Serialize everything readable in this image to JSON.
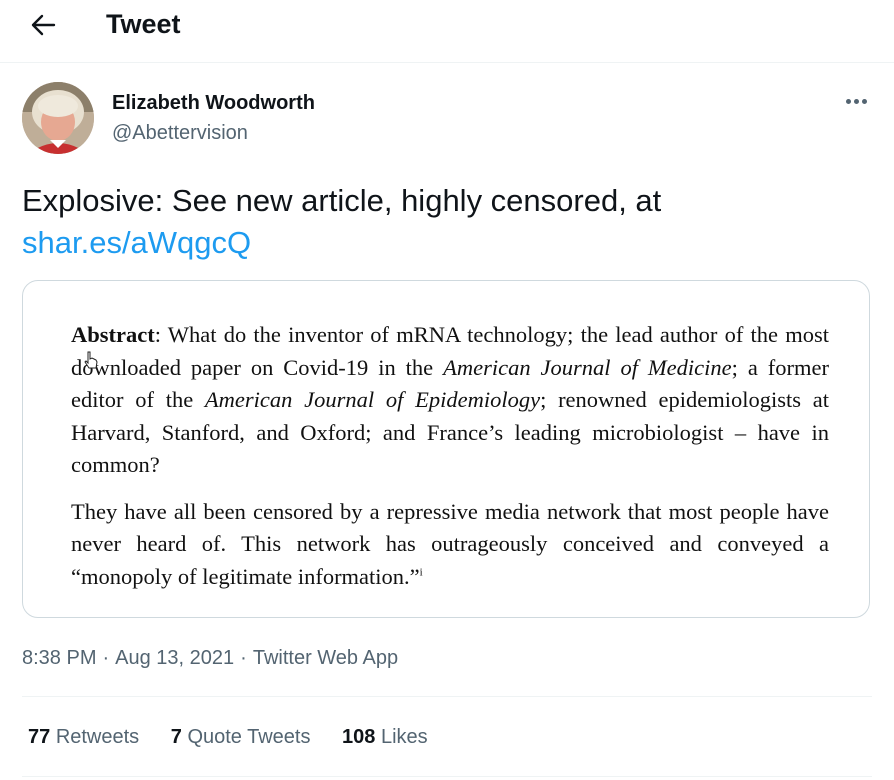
{
  "header": {
    "title": "Tweet",
    "back_icon": "arrow-left-icon"
  },
  "author": {
    "name": "Elizabeth Woodworth",
    "handle": "@Abettervision"
  },
  "tweet": {
    "text": "Explosive:  See new article, highly censored, at",
    "link": "shar.es/aWqgcQ"
  },
  "media": {
    "abstract_label": "Abstract",
    "p1_a": ":  What do the inventor of mRNA technology; the lead author of the most downloaded paper on Covid-19 in the ",
    "p1_journal1": "American Journal of Medicine",
    "p1_b": "; a former editor of the ",
    "p1_journal2": "American Journal of Epidemiology",
    "p1_c": "; renowned epidemiologists at Harvard, Stanford, and Oxford; and France’s leading microbiologist – have in common?",
    "p2": "They have all been censored by a repressive media network that most people have never heard of. This network has outrageously conceived and conveyed a “monopoly of legitimate information.”",
    "p2_note": "i"
  },
  "meta": {
    "time": "8:38 PM",
    "date": "Aug 13, 2021",
    "source": "Twitter Web App"
  },
  "stats": {
    "retweets_count": "77",
    "retweets_label": "Retweets",
    "quotes_count": "7",
    "quotes_label": "Quote Tweets",
    "likes_count": "108",
    "likes_label": "Likes"
  },
  "colors": {
    "link": "#1d9bf0",
    "secondary_text": "#536471",
    "border": "#cfd9de"
  }
}
